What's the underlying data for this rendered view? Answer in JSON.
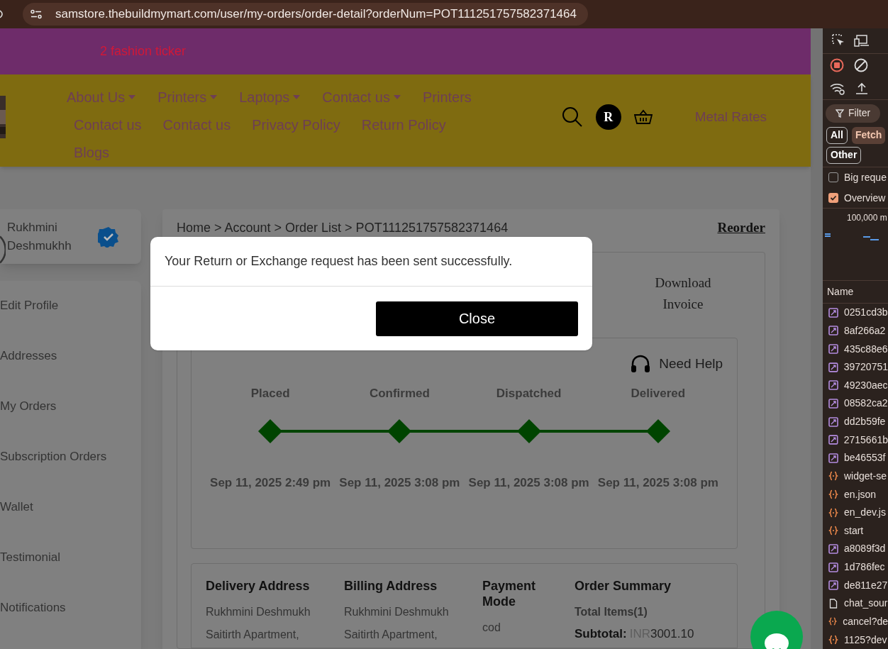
{
  "browser": {
    "url": "samstore.thebuildmymart.com/user/my-orders/order-detail?orderNum=POT111251757582371464"
  },
  "ticker": {
    "text": "2 fashion ticker"
  },
  "nav": {
    "rows": [
      [
        {
          "label": "About Us",
          "dropdown": true
        },
        {
          "label": "Printers",
          "dropdown": true
        },
        {
          "label": "Laptops",
          "dropdown": true
        },
        {
          "label": "Contact us",
          "dropdown": true
        },
        {
          "label": "Printers",
          "dropdown": false
        }
      ],
      [
        {
          "label": "Contact us",
          "dropdown": false
        },
        {
          "label": "Contact us",
          "dropdown": false
        },
        {
          "label": "Privacy Policy",
          "dropdown": false
        },
        {
          "label": "Return Policy",
          "dropdown": false
        }
      ],
      [
        {
          "label": "Blogs",
          "dropdown": false
        }
      ]
    ],
    "avatar_letter": "R",
    "metal_rates": "Metal Rates"
  },
  "profile": {
    "name": "Rukhmini Deshmukhh",
    "verified": true
  },
  "sidebar": {
    "items": [
      "Edit Profile",
      "Addresses",
      "My Orders",
      "Subscription Orders",
      "Wallet",
      "Testimonial",
      "Notifications"
    ]
  },
  "order": {
    "breadcrumb": "Home > Account > Order List > POT111251757582371464",
    "reorder": "Reorder",
    "download_invoice": "Download Invoice",
    "need_help": "Need Help",
    "steps": [
      {
        "label": "Placed",
        "date": "Sep 11, 2025 2:49 pm",
        "completed": true
      },
      {
        "label": "Confirmed",
        "date": "Sep 11, 2025 3:08 pm",
        "completed": true
      },
      {
        "label": "Dispatched",
        "date": "Sep 11, 2025 3:08 pm",
        "completed": true
      },
      {
        "label": "Delivered",
        "date": "Sep 11, 2025 3:08 pm",
        "completed": true
      }
    ],
    "details": [
      {
        "heading": "Delivery Address",
        "lines": [
          "Rukhmini Deshmukh",
          "Saitirth Apartment,"
        ]
      },
      {
        "heading": "Billing Address",
        "lines": [
          "Rukhmini Deshmukh",
          "Saitirth Apartment,"
        ]
      },
      {
        "heading": "Payment Mode",
        "lines": [
          "cod"
        ]
      }
    ],
    "summary": {
      "heading": "Order Summary",
      "total_items": "Total Items(1)",
      "subtotal_label": "Subtotal:",
      "currency": "INR",
      "subtotal": "3001.10"
    }
  },
  "modal": {
    "message": "Your Return or Exchange request has been sent successfully.",
    "button": "Close"
  },
  "devtools": {
    "filter": "Filter",
    "chips": [
      {
        "label": "All",
        "selected": false
      },
      {
        "label": "Fetch",
        "selected": true
      }
    ],
    "other": "Other",
    "options": [
      {
        "label": "Big reque",
        "checked": false
      },
      {
        "label": "Overview",
        "checked": true
      }
    ],
    "overview_label": "100,000 m",
    "name_header": "Name",
    "requests": [
      {
        "kind": "fetch",
        "name": "0251cd3b"
      },
      {
        "kind": "fetch",
        "name": "8af266a2"
      },
      {
        "kind": "fetch",
        "name": "435c88e6"
      },
      {
        "kind": "fetch",
        "name": "39720751"
      },
      {
        "kind": "fetch",
        "name": "49230aec"
      },
      {
        "kind": "fetch",
        "name": "08582ca2"
      },
      {
        "kind": "fetch",
        "name": "dd2b59fe"
      },
      {
        "kind": "fetch",
        "name": "2715661b"
      },
      {
        "kind": "fetch",
        "name": "be46553f"
      },
      {
        "kind": "script",
        "name": "widget-se"
      },
      {
        "kind": "script",
        "name": "en.json"
      },
      {
        "kind": "script",
        "name": "en_dev.js"
      },
      {
        "kind": "script",
        "name": "start"
      },
      {
        "kind": "fetch",
        "name": "a8089f3d"
      },
      {
        "kind": "fetch",
        "name": "1d786fec"
      },
      {
        "kind": "fetch",
        "name": "de811e27"
      },
      {
        "kind": "doc",
        "name": "chat_sour"
      },
      {
        "kind": "script",
        "name": "cancel?de"
      },
      {
        "kind": "script",
        "name": "1125?dev"
      }
    ]
  }
}
